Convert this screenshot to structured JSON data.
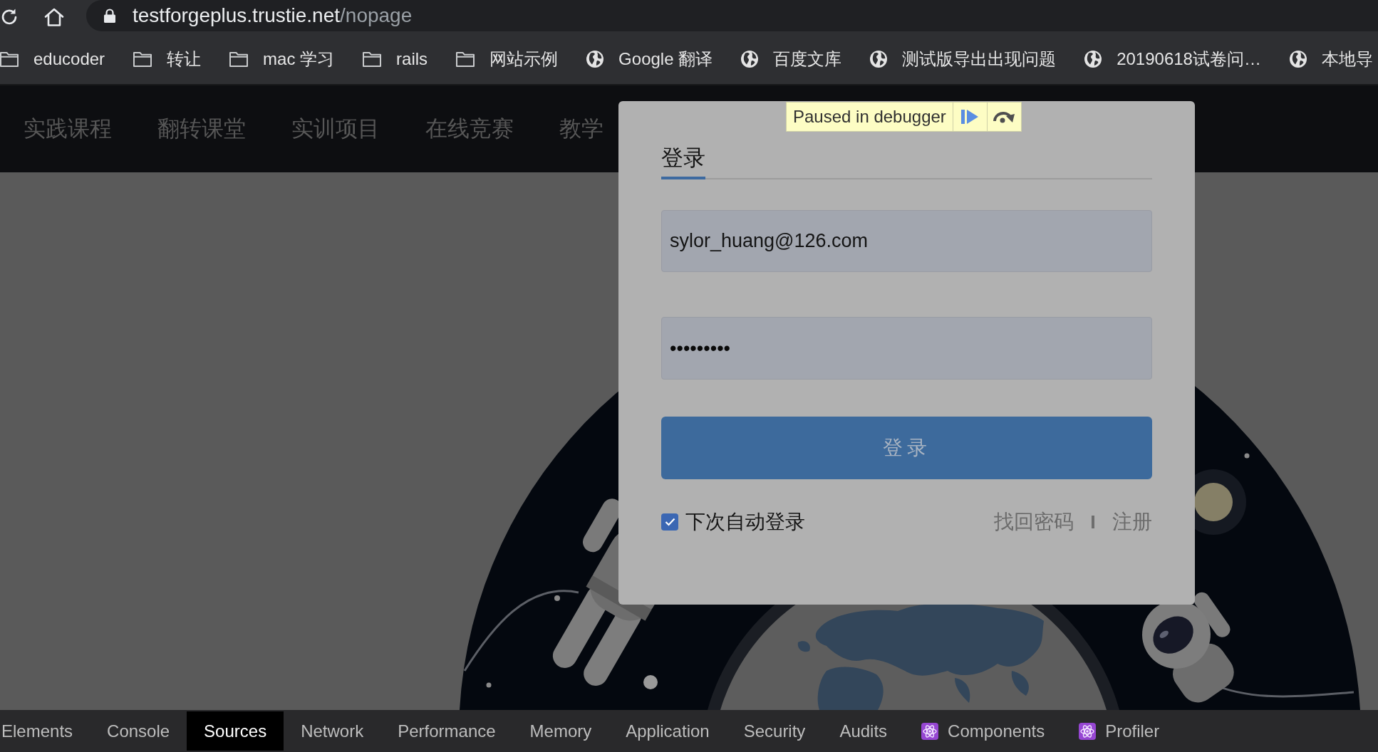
{
  "browser": {
    "url_host": "testforgeplus.trustie.net",
    "url_path": "/nopage"
  },
  "bookmarks": [
    {
      "kind": "folder",
      "label": "educoder"
    },
    {
      "kind": "folder",
      "label": "转让"
    },
    {
      "kind": "folder",
      "label": "mac 学习"
    },
    {
      "kind": "folder",
      "label": "rails"
    },
    {
      "kind": "folder",
      "label": "网站示例"
    },
    {
      "kind": "site",
      "label": "Google 翻译"
    },
    {
      "kind": "site",
      "label": "百度文库"
    },
    {
      "kind": "site",
      "label": "测试版导出出现问题"
    },
    {
      "kind": "site",
      "label": "20190618试卷问…"
    },
    {
      "kind": "site",
      "label": "本地导"
    }
  ],
  "site_nav": {
    "items": [
      "实践课程",
      "翻转课堂",
      "实训项目",
      "在线竞赛",
      "教学"
    ]
  },
  "debugger_banner": {
    "text": "Paused in debugger"
  },
  "login_dialog": {
    "tabs": [
      {
        "label": "登录",
        "selected": true
      }
    ],
    "email": {
      "value": "sylor_huang@126.com"
    },
    "password": {
      "value": "•••••••••"
    },
    "submit": {
      "label": "登录"
    },
    "remember_me": {
      "label": "下次自动登录",
      "checked": true
    },
    "links": [
      "找回密码",
      "注册"
    ]
  },
  "devtools": {
    "tabs": [
      {
        "label": "Elements",
        "kind": "plain",
        "selected": false
      },
      {
        "label": "Console",
        "kind": "plain",
        "selected": false
      },
      {
        "label": "Sources",
        "kind": "plain",
        "selected": true
      },
      {
        "label": "Network",
        "kind": "plain",
        "selected": false
      },
      {
        "label": "Performance",
        "kind": "plain",
        "selected": false
      },
      {
        "label": "Memory",
        "kind": "plain",
        "selected": false
      },
      {
        "label": "Application",
        "kind": "plain",
        "selected": false
      },
      {
        "label": "Security",
        "kind": "plain",
        "selected": false
      },
      {
        "label": "Audits",
        "kind": "plain",
        "selected": false
      },
      {
        "label": "Components",
        "kind": "react",
        "selected": false
      },
      {
        "label": "Profiler",
        "kind": "react",
        "selected": false
      }
    ]
  }
}
